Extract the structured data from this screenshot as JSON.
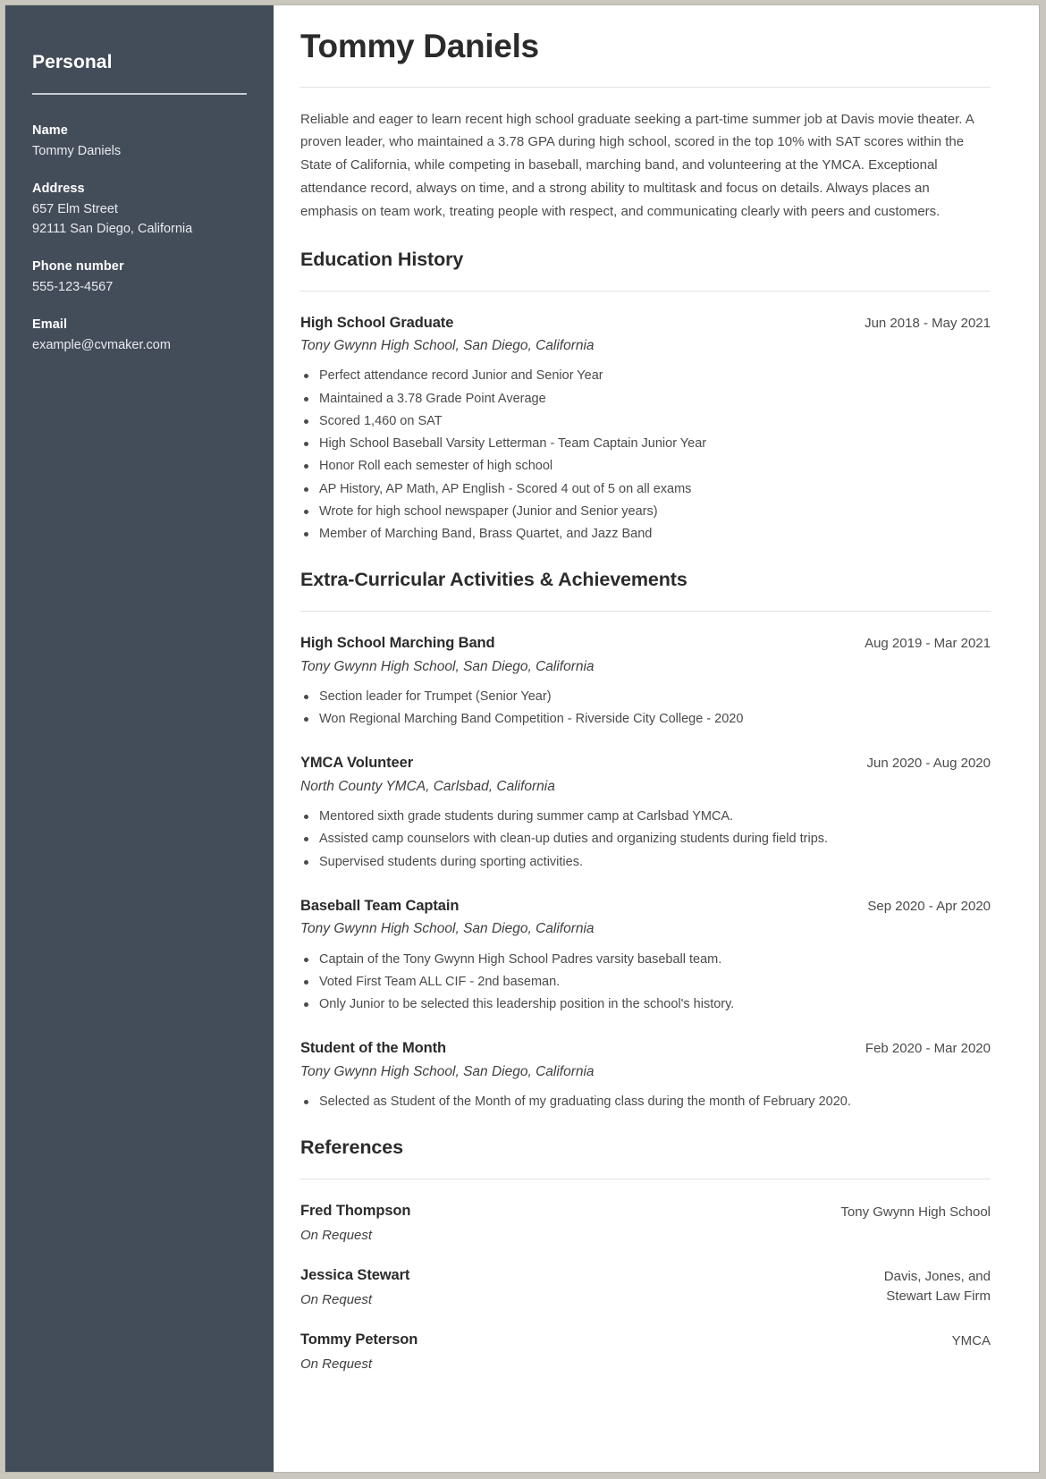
{
  "sidebar": {
    "title": "Personal",
    "fields": [
      {
        "label": "Name",
        "lines": [
          "Tommy Daniels"
        ]
      },
      {
        "label": "Address",
        "lines": [
          "657 Elm Street",
          "92111 San Diego, California"
        ]
      },
      {
        "label": "Phone number",
        "lines": [
          "555-123-4567"
        ]
      },
      {
        "label": "Email",
        "lines": [
          "example@cvmaker.com"
        ]
      }
    ]
  },
  "main": {
    "name": "Tommy Daniels",
    "summary": "Reliable and eager to learn recent high school graduate seeking a part-time summer job at Davis movie theater. A proven leader, who maintained a 3.78 GPA during high school, scored in the top 10% with SAT scores within the State of California, while competing in baseball, marching band, and volunteering at the YMCA. Exceptional attendance record, always on time, and a strong ability to multitask and focus on details. Always places an emphasis on team work, treating people with respect, and communicating clearly with peers and customers.",
    "sections": [
      {
        "heading": "Education History",
        "entries": [
          {
            "title": "High School Graduate",
            "date": "Jun 2018 - May 2021",
            "subtitle": "Tony Gwynn High School, San Diego, California",
            "bullets": [
              "Perfect attendance record Junior and Senior Year",
              "Maintained a 3.78 Grade Point Average",
              "Scored 1,460 on SAT",
              "High School Baseball Varsity Letterman - Team Captain Junior Year",
              "Honor Roll each semester of high school",
              "AP History, AP Math, AP English - Scored 4 out of 5 on all exams",
              "Wrote for high school newspaper (Junior and Senior years)",
              "Member of Marching Band, Brass Quartet, and Jazz Band"
            ]
          }
        ]
      },
      {
        "heading": "Extra-Curricular Activities & Achievements",
        "entries": [
          {
            "title": "High School Marching Band",
            "date": "Aug 2019 - Mar 2021",
            "subtitle": "Tony Gwynn High School, San Diego, California",
            "bullets": [
              "Section leader for Trumpet (Senior Year)",
              "Won Regional Marching Band Competition - Riverside City College - 2020"
            ]
          },
          {
            "title": "YMCA Volunteer",
            "date": "Jun 2020 - Aug 2020",
            "subtitle": "North County YMCA, Carlsbad, California",
            "bullets": [
              "Mentored sixth grade students during summer camp at Carlsbad YMCA.",
              "Assisted camp counselors with clean-up duties and organizing students during field trips.",
              "Supervised students during sporting activities."
            ]
          },
          {
            "title": "Baseball Team Captain",
            "date": "Sep 2020 - Apr 2020",
            "subtitle": "Tony Gwynn High School, San Diego, California",
            "bullets": [
              "Captain of the Tony Gwynn High School Padres varsity baseball team.",
              "Voted First Team ALL CIF - 2nd baseman.",
              "Only Junior to be selected this leadership position in the school's history."
            ]
          },
          {
            "title": "Student of the Month",
            "date": "Feb 2020 - Mar 2020",
            "subtitle": "Tony Gwynn High School, San Diego, California",
            "bullets": [
              "Selected as Student of the Month of my graduating class during the month of February 2020."
            ]
          }
        ]
      }
    ],
    "references": {
      "heading": "References",
      "items": [
        {
          "name": "Fred Thompson",
          "status": "On Request",
          "organization": "Tony Gwynn High School"
        },
        {
          "name": "Jessica Stewart",
          "status": "On Request",
          "organization": "Davis, Jones, and Stewart Law Firm"
        },
        {
          "name": "Tommy Peterson",
          "status": "On Request",
          "organization": "YMCA"
        }
      ]
    }
  }
}
